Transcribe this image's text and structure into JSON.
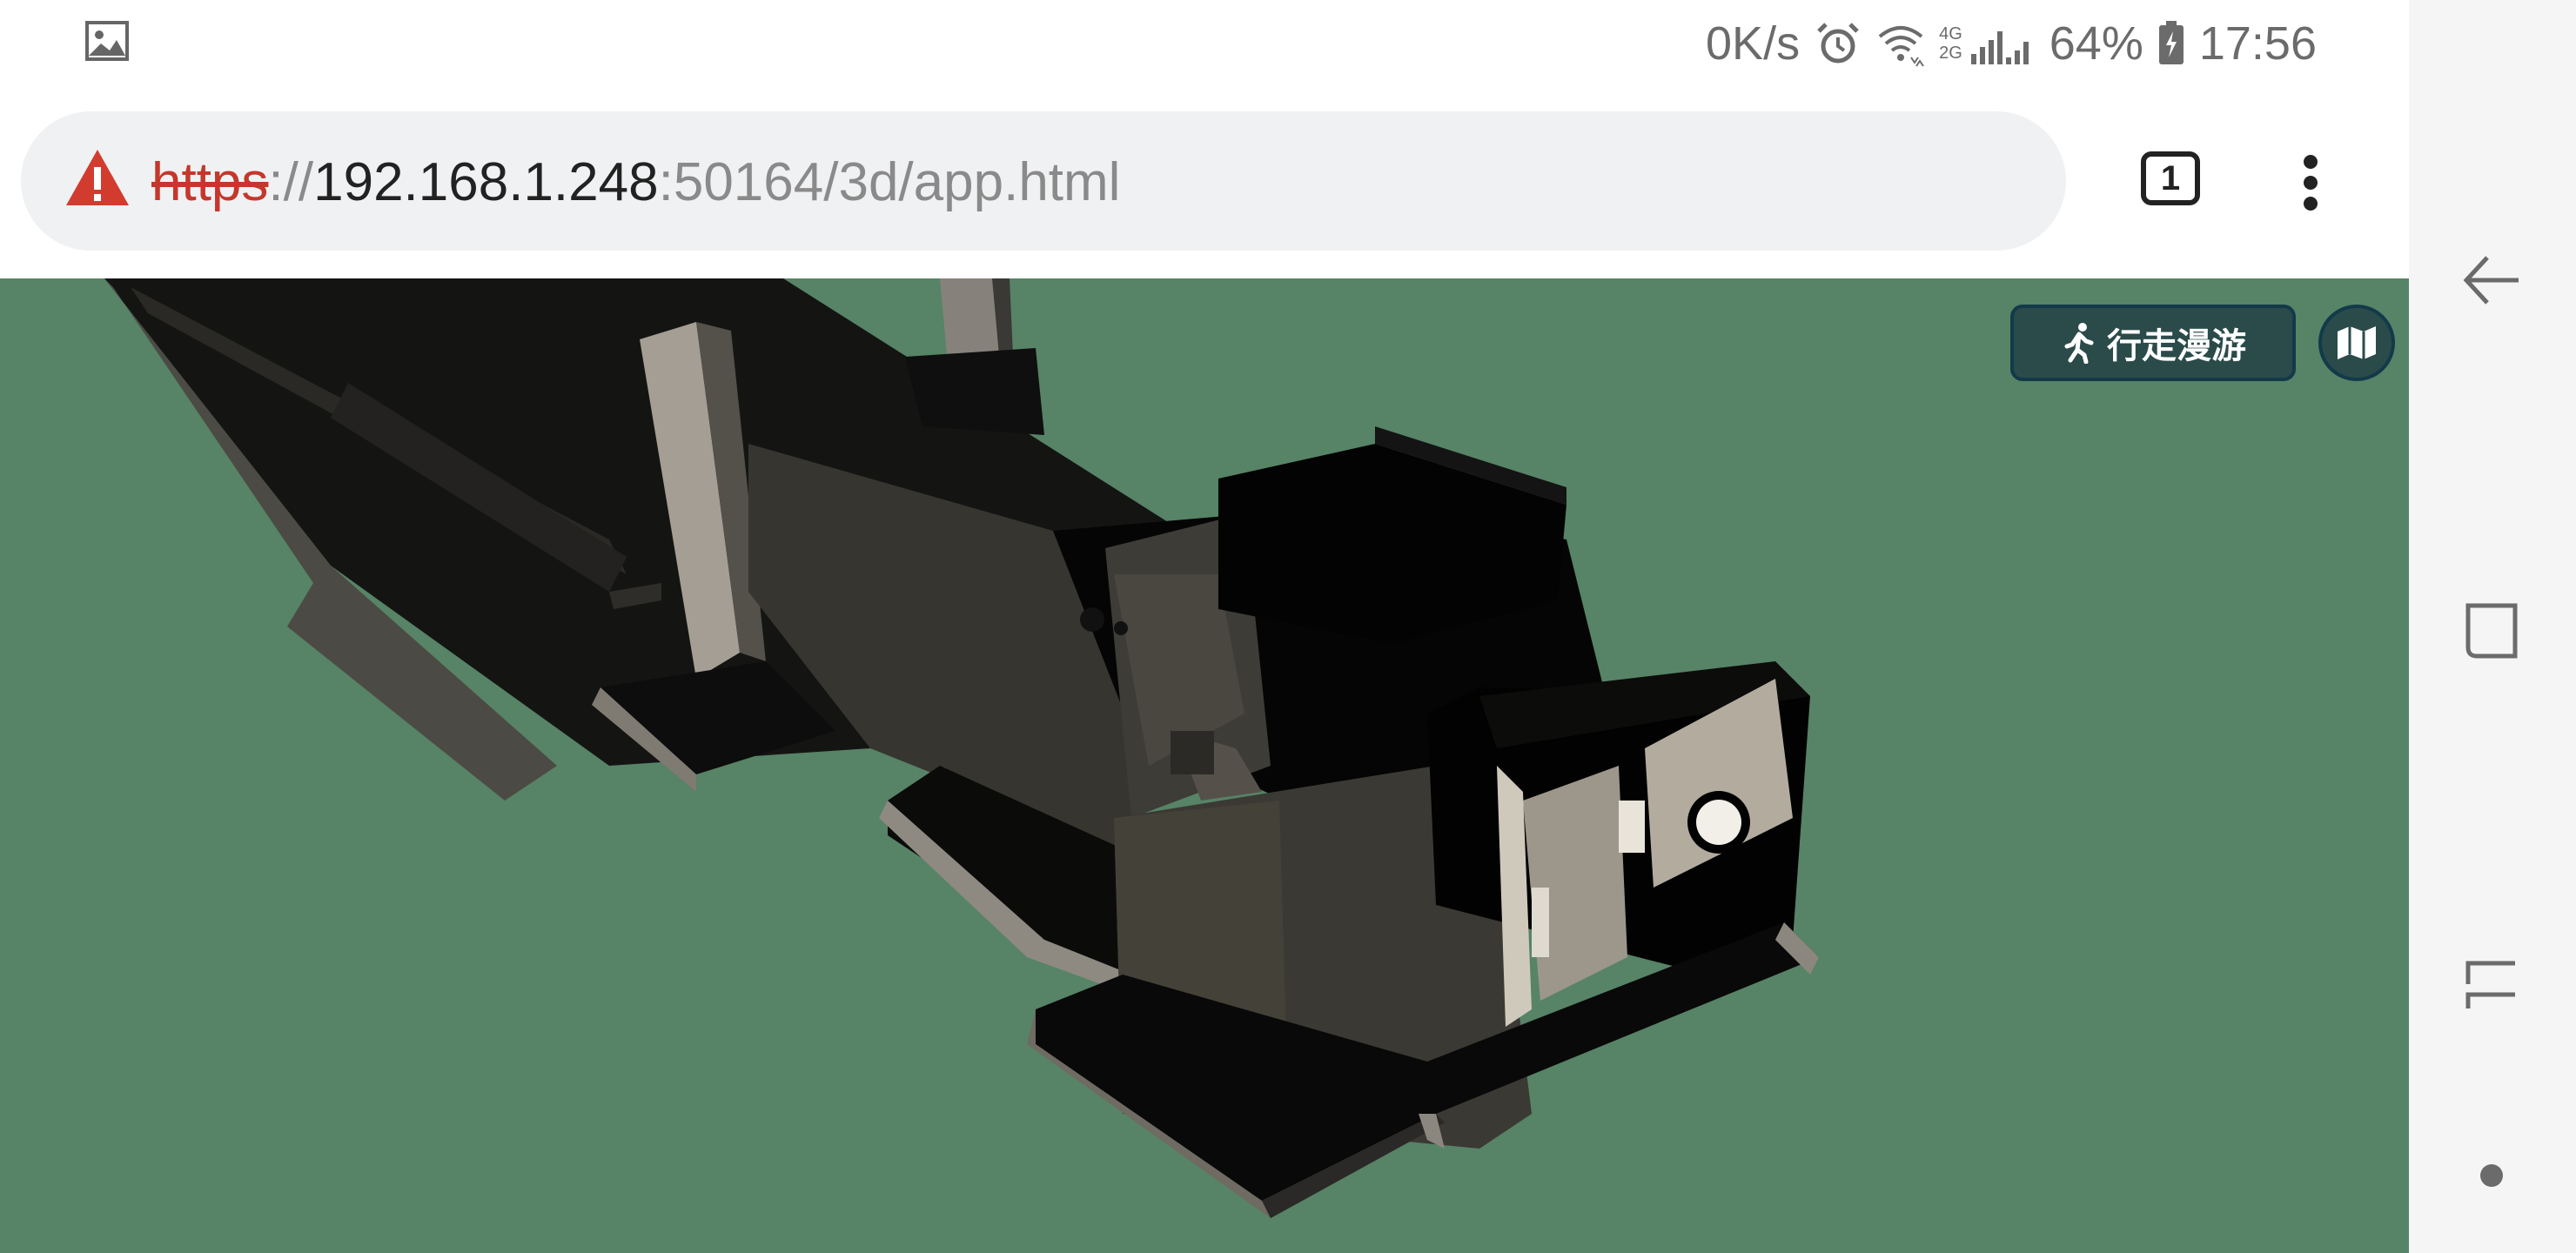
{
  "status_bar": {
    "left_icon": "gallery-image-icon",
    "net_speed": "0K/s",
    "alarm_icon": "alarm-clock-icon",
    "wifi_icon": "wifi-icon",
    "network_top": "4G",
    "network_bottom": "2G",
    "signal_icon": "cell-signal-icon",
    "battery_percent": "64%",
    "battery_icon": "battery-charging-icon",
    "time": "17:56"
  },
  "browser": {
    "security_icon": "warning-triangle-icon",
    "url": {
      "scheme": "https",
      "separator": "://",
      "host": "192.168.1.248",
      "path": ":50164/3d/app.html"
    },
    "tab_count": "1",
    "menu_icon": "more-vert-icon"
  },
  "viewer": {
    "background_color": "#578366",
    "walk_mode_label": "行走漫游",
    "walk_icon": "walking-person-icon",
    "map_icon": "map-icon",
    "button_color": "#2b4b4a"
  },
  "nav_bar": {
    "back_icon": "back-arrow-icon",
    "recents_icon": "recent-apps-icon",
    "home_icon": "home-icon",
    "dot_icon": "dot-indicator"
  }
}
